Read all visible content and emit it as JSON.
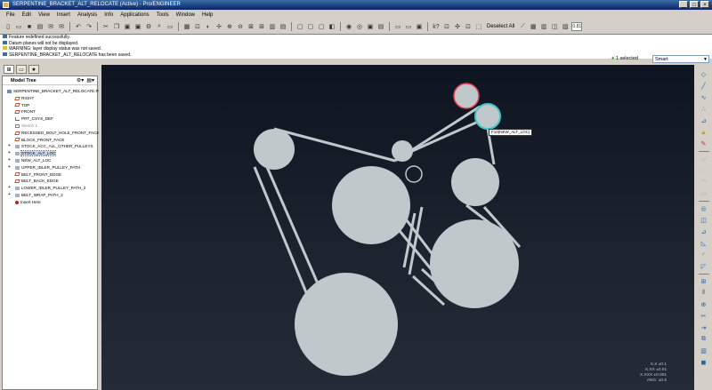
{
  "window": {
    "title": "SERPENTINE_BRACKET_ALT_RELOCATE (Active) - Pro/ENGINEER",
    "controls": [
      "_",
      "□",
      "×"
    ]
  },
  "menu": [
    "File",
    "Edit",
    "View",
    "Insert",
    "Analysis",
    "Info",
    "Applications",
    "Tools",
    "Window",
    "Help"
  ],
  "toolbar": {
    "deselect_all_label": "Deselect All",
    "zoom_readout": "0.81"
  },
  "messages": [
    {
      "icon": "info-icon",
      "text": "Feature redefined successfully."
    },
    {
      "icon": "info-icon",
      "text": "Datum planes will not be displayed."
    },
    {
      "icon": "warning-icon",
      "text": "WARNING: layer display status was not saved."
    },
    {
      "icon": "info-icon",
      "text": "SERPENTINE_BRACKET_ALT_RELOCATE has been saved."
    }
  ],
  "selection": {
    "count_text": "1 selected",
    "filter_value": "Smart"
  },
  "model_tree": {
    "header": "Model Tree",
    "root": "SERPENTINE_BRACKET_ALT_RELOCATE.PRT",
    "items": [
      {
        "label": "RIGHT",
        "icon": "plane",
        "expandable": false,
        "state": ""
      },
      {
        "label": "TOP",
        "icon": "plane",
        "expandable": false,
        "state": ""
      },
      {
        "label": "FRONT",
        "icon": "plane",
        "expandable": false,
        "state": ""
      },
      {
        "label": "PRT_CSYS_DEF",
        "icon": "csys",
        "expandable": false,
        "state": ""
      },
      {
        "label": "Sketch 1",
        "icon": "sketch",
        "expandable": false,
        "state": "dim"
      },
      {
        "label": "RECESSED_BOLT_HOLE_FRONT_FACES",
        "icon": "plane",
        "expandable": false,
        "state": ""
      },
      {
        "label": "BLOCK_FRONT_FACE",
        "icon": "plane",
        "expandable": false,
        "state": ""
      },
      {
        "label": "STOCK_ACC_ALL_OTHER_PULLEYS",
        "icon": "feat",
        "expandable": true,
        "state": ""
      },
      {
        "label": "STOCK_ALT_LOC",
        "icon": "feat",
        "expandable": true,
        "state": "hl"
      },
      {
        "label": "NEW_ALT_LOC",
        "icon": "feat",
        "expandable": true,
        "state": ""
      },
      {
        "label": "UPPER_IDLER_PULLEY_PATH",
        "icon": "feat",
        "expandable": true,
        "state": ""
      },
      {
        "label": "BELT_FRONT_EDGE",
        "icon": "plane",
        "expandable": false,
        "state": ""
      },
      {
        "label": "BELT_BACK_EDGE",
        "icon": "plane",
        "expandable": false,
        "state": ""
      },
      {
        "label": "LOWER_IDLER_PULLEY_PATH_2",
        "icon": "feat",
        "expandable": true,
        "state": ""
      },
      {
        "label": "BELT_WRAP_PATH_2",
        "icon": "feat",
        "expandable": true,
        "state": ""
      },
      {
        "label": "Insert Here",
        "icon": "insert",
        "expandable": false,
        "state": ""
      }
    ]
  },
  "viewport": {
    "tooltip": "F10(NEW_ALT_LOC)",
    "tolerances": [
      "X.X ±0.1",
      "X.XX ±0.01",
      "X.XXX ±0.001",
      "ANG. ±0.5"
    ],
    "colors": {
      "pulley": "#c0c8cc",
      "preselect": "#e84050",
      "selected": "#40c8c8",
      "belt": "#c0c8cc"
    }
  }
}
